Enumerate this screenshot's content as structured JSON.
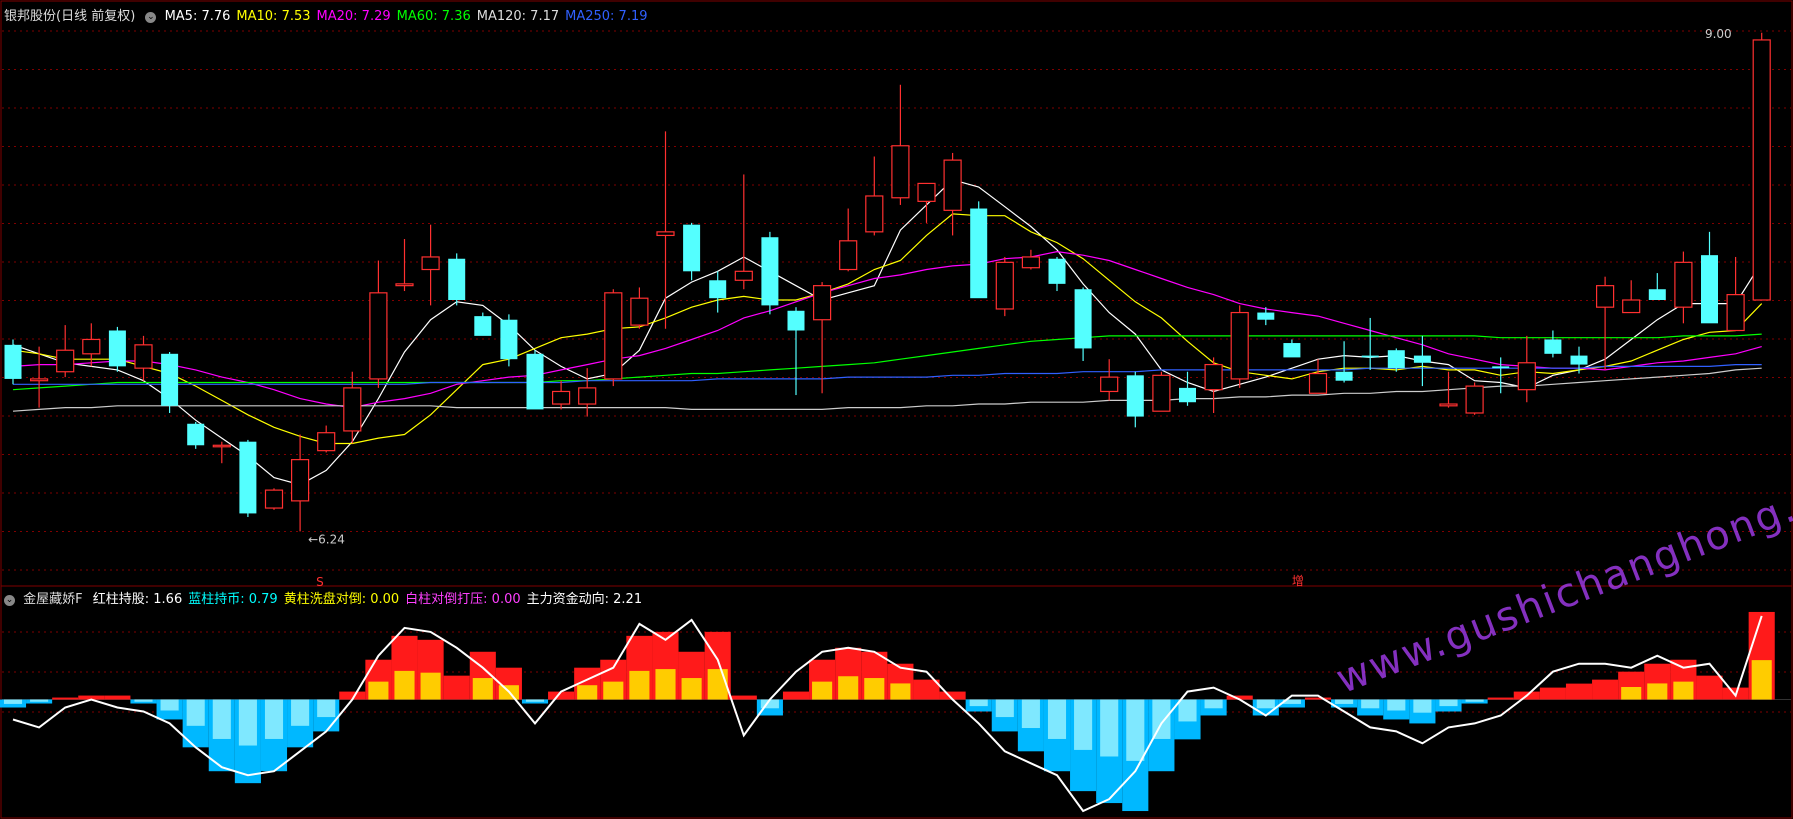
{
  "main_legend": {
    "title": "银邦股份(日线 前复权)",
    "items": [
      {
        "label": "MA5: 7.76",
        "color": "#ffffff"
      },
      {
        "label": "MA10: 7.53",
        "color": "#ffff00"
      },
      {
        "label": "MA20: 7.29",
        "color": "#ff00ff"
      },
      {
        "label": "MA60: 7.36",
        "color": "#00ff00"
      },
      {
        "label": "MA120: 7.17",
        "color": "#dddddd"
      },
      {
        "label": "MA250: 7.19",
        "color": "#3060ff"
      }
    ]
  },
  "indicator_legend": {
    "title": "金屋藏娇F",
    "items": [
      {
        "label": "红柱持股: 1.66",
        "color": "#ffffff"
      },
      {
        "label": "蓝柱持币: 0.79",
        "color": "#00ffff"
      },
      {
        "label": "黄柱洗盘对倒: 0.00",
        "color": "#ffff00"
      },
      {
        "label": "白柱对倒打压: 0.00",
        "color": "#ff40ff"
      },
      {
        "label": "主力资金动向: 2.21",
        "color": "#ffffff"
      }
    ]
  },
  "annotations": {
    "high_label": "9.00",
    "low_label": "6.24",
    "marker_s": "S",
    "marker_zeng": "增"
  },
  "watermark": "www.gushichanghong.com",
  "colors": {
    "up": "#ff3030",
    "down": "#54ffff",
    "grid": "#800000"
  },
  "chart_data": {
    "type": "candlestick",
    "price_range": [
      6.0,
      9.1
    ],
    "candles": [
      [
        7.3,
        7.11,
        7.33,
        7.08
      ],
      [
        7.1,
        7.11,
        7.29,
        6.95
      ],
      [
        7.15,
        7.27,
        7.41,
        7.12
      ],
      [
        7.25,
        7.33,
        7.42,
        7.18
      ],
      [
        7.38,
        7.18,
        7.4,
        7.15
      ],
      [
        7.17,
        7.3,
        7.35,
        7.1
      ],
      [
        7.25,
        6.96,
        7.26,
        6.92
      ],
      [
        6.86,
        6.74,
        6.87,
        6.72
      ],
      [
        6.74,
        6.74,
        6.76,
        6.64
      ],
      [
        6.76,
        6.36,
        6.77,
        6.34
      ],
      [
        6.39,
        6.49,
        6.5,
        6.38
      ],
      [
        6.43,
        6.66,
        6.8,
        6.26
      ],
      [
        6.71,
        6.81,
        6.85,
        6.7
      ],
      [
        6.82,
        7.06,
        7.15,
        6.75
      ],
      [
        7.11,
        7.59,
        7.77,
        7.06
      ],
      [
        7.63,
        7.64,
        7.89,
        7.6
      ],
      [
        7.72,
        7.79,
        7.97,
        7.52
      ],
      [
        7.78,
        7.55,
        7.81,
        7.52
      ],
      [
        7.46,
        7.35,
        7.48,
        7.36
      ],
      [
        7.44,
        7.22,
        7.47,
        7.18
      ],
      [
        7.25,
        6.94,
        7.27,
        6.98
      ],
      [
        6.97,
        7.04,
        7.1,
        6.94
      ],
      [
        6.97,
        7.06,
        7.17,
        6.9
      ],
      [
        7.11,
        7.59,
        7.61,
        7.07
      ],
      [
        7.41,
        7.56,
        7.62,
        7.39
      ],
      [
        7.91,
        7.93,
        8.49,
        7.39
      ],
      [
        7.97,
        7.71,
        7.98,
        7.66
      ],
      [
        7.66,
        7.56,
        7.71,
        7.48
      ],
      [
        7.66,
        7.71,
        8.25,
        7.61
      ],
      [
        7.9,
        7.52,
        7.93,
        7.47
      ],
      [
        7.49,
        7.38,
        7.51,
        7.02
      ],
      [
        7.44,
        7.63,
        7.65,
        7.03
      ],
      [
        7.72,
        7.88,
        8.06,
        7.71
      ],
      [
        7.93,
        8.13,
        8.35,
        7.91
      ],
      [
        8.12,
        8.41,
        8.75,
        8.08
      ],
      [
        8.1,
        8.2,
        8.2,
        7.98
      ],
      [
        8.05,
        8.33,
        8.37,
        7.91
      ],
      [
        8.06,
        7.56,
        8.1,
        7.59
      ],
      [
        7.5,
        7.76,
        7.79,
        7.46
      ],
      [
        7.73,
        7.79,
        7.83,
        7.72
      ],
      [
        7.78,
        7.64,
        7.79,
        7.6
      ],
      [
        7.61,
        7.28,
        7.62,
        7.21
      ],
      [
        7.04,
        7.12,
        7.22,
        6.99
      ],
      [
        7.13,
        6.9,
        7.15,
        6.84
      ],
      [
        6.93,
        7.13,
        7.15,
        6.94
      ],
      [
        7.06,
        6.98,
        7.15,
        6.96
      ],
      [
        7.05,
        7.19,
        7.23,
        6.92
      ],
      [
        7.11,
        7.48,
        7.52,
        7.06
      ],
      [
        7.48,
        7.44,
        7.51,
        7.41
      ],
      [
        7.31,
        7.23,
        7.33,
        7.26
      ],
      [
        7.03,
        7.14,
        7.22,
        7.05
      ],
      [
        7.15,
        7.1,
        7.32,
        7.09
      ],
      [
        7.24,
        7.23,
        7.45,
        7.16
      ],
      [
        7.27,
        7.17,
        7.28,
        7.15
      ],
      [
        7.24,
        7.2,
        7.35,
        7.07
      ],
      [
        6.96,
        6.97,
        7.15,
        6.95
      ],
      [
        6.92,
        7.07,
        7.09,
        6.91
      ],
      [
        7.18,
        7.17,
        7.23,
        7.03
      ],
      [
        7.05,
        7.2,
        7.35,
        6.98
      ],
      [
        7.33,
        7.25,
        7.38,
        7.23
      ],
      [
        7.24,
        7.19,
        7.29,
        7.14
      ],
      [
        7.51,
        7.63,
        7.68,
        7.16
      ],
      [
        7.48,
        7.55,
        7.66,
        7.5
      ],
      [
        7.61,
        7.55,
        7.7,
        7.58
      ],
      [
        7.51,
        7.76,
        7.82,
        7.42
      ],
      [
        7.8,
        7.42,
        7.93,
        7.44
      ],
      [
        7.38,
        7.58,
        7.79,
        7.4
      ],
      [
        7.55,
        9.0,
        9.04,
        7.58
      ]
    ],
    "ma_lines": {
      "ma5": [
        7.3,
        7.25,
        7.2,
        7.18,
        7.16,
        7.1,
        7.0,
        6.88,
        6.78,
        6.68,
        6.56,
        6.52,
        6.6,
        6.76,
        7.0,
        7.26,
        7.44,
        7.54,
        7.52,
        7.41,
        7.27,
        7.18,
        7.11,
        7.14,
        7.27,
        7.56,
        7.65,
        7.71,
        7.79,
        7.71,
        7.63,
        7.55,
        7.59,
        7.63,
        7.94,
        8.08,
        8.22,
        8.18,
        8.07,
        7.96,
        7.83,
        7.64,
        7.48,
        7.36,
        7.16,
        7.09,
        7.04,
        7.08,
        7.12,
        7.17,
        7.22,
        7.24,
        7.23,
        7.24,
        7.21,
        7.19,
        7.1,
        7.09,
        7.06,
        7.13,
        7.16,
        7.22,
        7.33,
        7.44,
        7.53,
        7.53,
        7.53,
        7.76
      ],
      "ma10": [
        7.27,
        7.25,
        7.22,
        7.22,
        7.22,
        7.18,
        7.14,
        7.07,
        6.99,
        6.91,
        6.84,
        6.79,
        6.75,
        6.75,
        6.78,
        6.8,
        6.91,
        7.05,
        7.19,
        7.22,
        7.28,
        7.34,
        7.36,
        7.39,
        7.4,
        7.45,
        7.51,
        7.55,
        7.57,
        7.55,
        7.55,
        7.59,
        7.64,
        7.72,
        7.77,
        7.91,
        8.03,
        8.02,
        8.02,
        7.93,
        7.87,
        7.78,
        7.66,
        7.54,
        7.45,
        7.32,
        7.2,
        7.15,
        7.13,
        7.11,
        7.15,
        7.17,
        7.17,
        7.16,
        7.18,
        7.16,
        7.16,
        7.13,
        7.15,
        7.14,
        7.16,
        7.18,
        7.21,
        7.27,
        7.33,
        7.37,
        7.38,
        7.53
      ],
      "ma20": [
        7.18,
        7.19,
        7.19,
        7.2,
        7.21,
        7.21,
        7.19,
        7.16,
        7.12,
        7.09,
        7.05,
        7.0,
        6.97,
        6.95,
        6.98,
        7.0,
        7.03,
        7.08,
        7.1,
        7.12,
        7.13,
        7.16,
        7.19,
        7.22,
        7.24,
        7.28,
        7.33,
        7.38,
        7.45,
        7.49,
        7.54,
        7.59,
        7.63,
        7.67,
        7.69,
        7.72,
        7.74,
        7.75,
        7.78,
        7.79,
        7.82,
        7.8,
        7.77,
        7.72,
        7.67,
        7.62,
        7.58,
        7.53,
        7.5,
        7.48,
        7.46,
        7.42,
        7.38,
        7.34,
        7.3,
        7.25,
        7.22,
        7.19,
        7.18,
        7.17,
        7.17,
        7.16,
        7.18,
        7.2,
        7.21,
        7.23,
        7.25,
        7.29
      ],
      "ma60": [
        7.05,
        7.06,
        7.07,
        7.08,
        7.09,
        7.09,
        7.09,
        7.09,
        7.09,
        7.09,
        7.09,
        7.09,
        7.09,
        7.09,
        7.09,
        7.09,
        7.09,
        7.09,
        7.09,
        7.09,
        7.09,
        7.1,
        7.1,
        7.11,
        7.12,
        7.13,
        7.14,
        7.14,
        7.15,
        7.16,
        7.17,
        7.18,
        7.19,
        7.2,
        7.22,
        7.24,
        7.26,
        7.28,
        7.3,
        7.32,
        7.33,
        7.34,
        7.35,
        7.35,
        7.35,
        7.35,
        7.35,
        7.35,
        7.35,
        7.35,
        7.35,
        7.35,
        7.35,
        7.35,
        7.35,
        7.35,
        7.35,
        7.34,
        7.34,
        7.34,
        7.34,
        7.34,
        7.34,
        7.34,
        7.35,
        7.35,
        7.35,
        7.36
      ],
      "ma120": [
        6.93,
        6.94,
        6.95,
        6.95,
        6.96,
        6.96,
        6.96,
        6.96,
        6.96,
        6.96,
        6.96,
        6.96,
        6.96,
        6.96,
        6.96,
        6.96,
        6.96,
        6.95,
        6.95,
        6.95,
        6.95,
        6.95,
        6.95,
        6.95,
        6.95,
        6.95,
        6.94,
        6.94,
        6.94,
        6.94,
        6.94,
        6.94,
        6.95,
        6.95,
        6.95,
        6.96,
        6.96,
        6.97,
        6.97,
        6.98,
        6.98,
        6.98,
        6.99,
        6.99,
        6.99,
        7.0,
        7.0,
        7.01,
        7.01,
        7.02,
        7.02,
        7.03,
        7.03,
        7.04,
        7.04,
        7.05,
        7.06,
        7.07,
        7.07,
        7.08,
        7.09,
        7.1,
        7.11,
        7.12,
        7.13,
        7.14,
        7.16,
        7.17
      ],
      "ma250": [
        7.08,
        7.08,
        7.08,
        7.08,
        7.08,
        7.08,
        7.08,
        7.08,
        7.08,
        7.08,
        7.08,
        7.08,
        7.08,
        7.08,
        7.08,
        7.08,
        7.09,
        7.09,
        7.09,
        7.09,
        7.09,
        7.09,
        7.1,
        7.1,
        7.1,
        7.1,
        7.1,
        7.11,
        7.11,
        7.11,
        7.11,
        7.11,
        7.12,
        7.12,
        7.12,
        7.12,
        7.13,
        7.13,
        7.14,
        7.14,
        7.14,
        7.15,
        7.15,
        7.15,
        7.16,
        7.16,
        7.16,
        7.16,
        7.16,
        7.16,
        7.16,
        7.16,
        7.17,
        7.17,
        7.17,
        7.17,
        7.17,
        7.17,
        7.17,
        7.17,
        7.17,
        7.18,
        7.18,
        7.18,
        7.18,
        7.18,
        7.19,
        7.19
      ]
    },
    "indicator": {
      "range": [
        -3.0,
        2.5
      ],
      "bars": [
        -0.2,
        -0.1,
        0.05,
        0.1,
        0.1,
        -0.1,
        -0.5,
        -1.2,
        -1.8,
        -2.1,
        -1.8,
        -1.2,
        -0.8,
        0.2,
        1.0,
        1.6,
        1.5,
        0.6,
        1.2,
        0.8,
        -0.1,
        0.2,
        0.8,
        1.0,
        1.6,
        1.7,
        1.2,
        1.7,
        0.1,
        -0.4,
        0.2,
        1.0,
        1.3,
        1.2,
        0.9,
        0.5,
        0.2,
        -0.3,
        -0.8,
        -1.3,
        -1.8,
        -2.3,
        -2.6,
        -2.8,
        -1.8,
        -1.0,
        -0.4,
        0.1,
        -0.4,
        -0.2,
        0.05,
        -0.2,
        -0.4,
        -0.5,
        -0.6,
        -0.3,
        -0.1,
        0.05,
        0.2,
        0.3,
        0.4,
        0.5,
        0.7,
        0.9,
        1.0,
        0.6,
        0.3,
        2.2
      ],
      "line": [
        -0.5,
        -0.7,
        -0.2,
        0.0,
        -0.2,
        -0.3,
        -0.6,
        -1.2,
        -1.7,
        -1.9,
        -1.8,
        -1.3,
        -0.8,
        0.0,
        1.1,
        1.8,
        1.7,
        1.3,
        0.8,
        0.2,
        -0.6,
        0.2,
        0.5,
        0.8,
        1.9,
        1.5,
        2.0,
        1.0,
        -0.9,
        0.0,
        0.7,
        1.2,
        1.3,
        1.2,
        0.8,
        0.7,
        0.0,
        -0.6,
        -1.3,
        -1.6,
        -1.9,
        -2.8,
        -2.5,
        -1.8,
        -0.6,
        0.2,
        0.3,
        0.0,
        -0.4,
        0.1,
        0.1,
        -0.3,
        -0.7,
        -0.8,
        -1.1,
        -0.7,
        -0.6,
        -0.4,
        0.1,
        0.7,
        0.9,
        0.9,
        0.8,
        1.1,
        0.8,
        0.9,
        0.1,
        2.1
      ]
    }
  }
}
